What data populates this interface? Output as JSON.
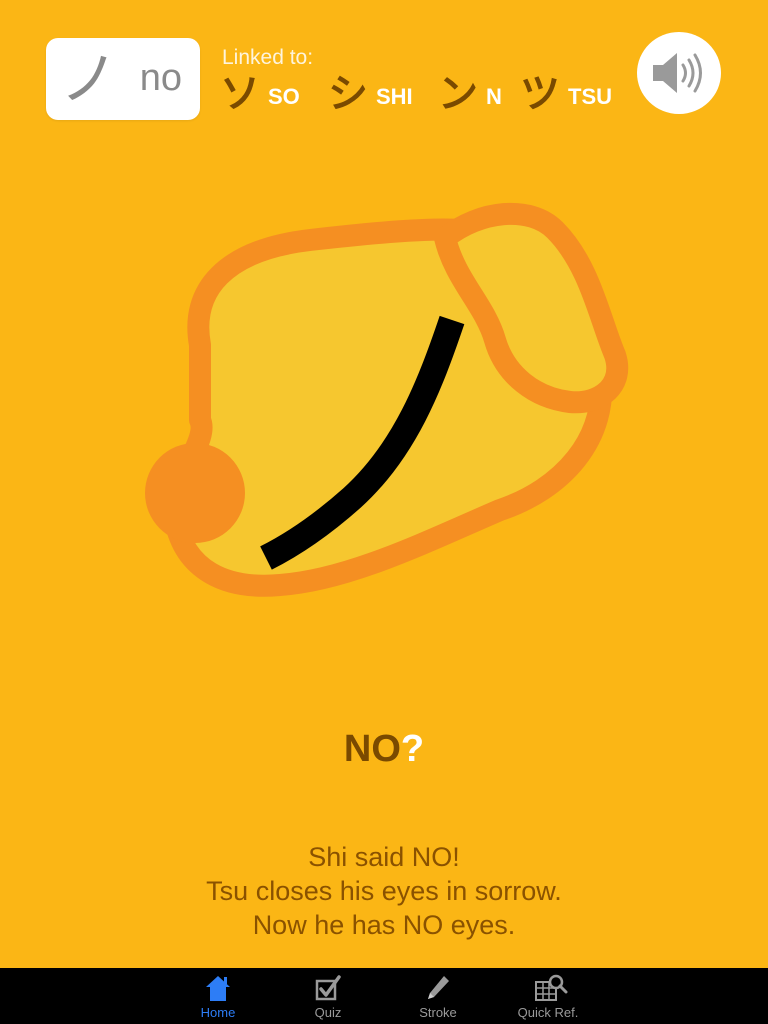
{
  "card": {
    "kana": "ノ",
    "romaji": "no"
  },
  "linked": {
    "label": "Linked to:",
    "items": [
      {
        "kana": "ソ",
        "romaji": "SO"
      },
      {
        "kana": "シ",
        "romaji": "SHI"
      },
      {
        "kana": "ン",
        "romaji": "N"
      },
      {
        "kana": "ツ",
        "romaji": "TSU"
      }
    ]
  },
  "sound_icon": "speaker-icon",
  "question": {
    "text": "NO",
    "mark": "?"
  },
  "story": {
    "lines": [
      "Shi said NO!",
      "Tsu closes his eyes in sorrow.",
      "Now he has NO eyes."
    ]
  },
  "tabs": [
    {
      "label": "Home",
      "icon": "home-icon",
      "active": true
    },
    {
      "label": "Quiz",
      "icon": "quiz-checkbox-icon",
      "active": false
    },
    {
      "label": "Stroke",
      "icon": "pencil-icon",
      "active": false
    },
    {
      "label": "Quick Ref.",
      "icon": "grid-search-icon",
      "active": false
    }
  ],
  "colors": {
    "background": "#FBB615",
    "blob_fill": "#F6C72F",
    "blob_outline": "#F58F22",
    "stroke": "#000000",
    "active_tab": "#2D7DF6"
  }
}
